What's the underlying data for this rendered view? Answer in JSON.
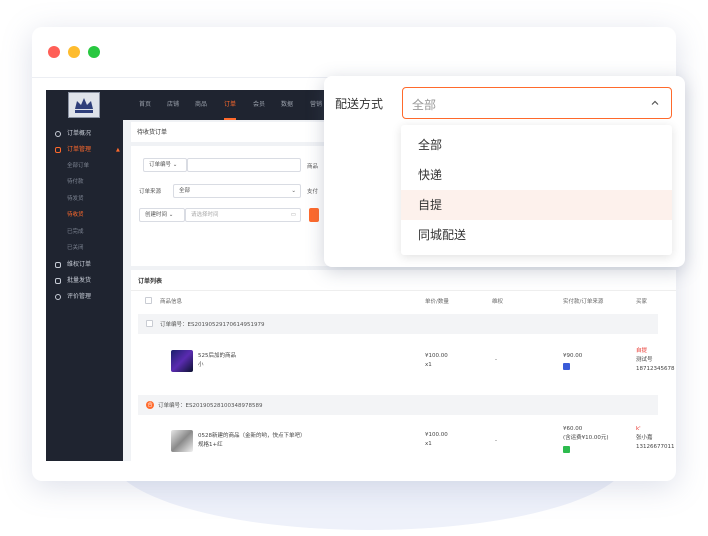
{
  "colors": {
    "accent": "#ff6a2c",
    "sidebar_bg": "#1f2430",
    "dot_red": "#ff5f57",
    "dot_yellow": "#febc2e",
    "dot_green": "#28c840"
  },
  "topnav": {
    "items": [
      "首页",
      "店铺",
      "商品",
      "订单",
      "会员",
      "数据",
      "营销"
    ]
  },
  "sidebar": {
    "items": [
      {
        "label": "订单概况",
        "icon": "clock-icon"
      },
      {
        "label": "订单管理",
        "icon": "document-icon"
      },
      {
        "label": "维权订单",
        "icon": "shield-icon"
      },
      {
        "label": "批量发货",
        "icon": "truck-icon"
      },
      {
        "label": "评价管理",
        "icon": "comment-icon"
      }
    ],
    "sub_items": [
      "全部订单",
      "待付款",
      "待发货",
      "待收货",
      "已完成",
      "已关闭"
    ],
    "active_sub": "待收货"
  },
  "page": {
    "breadcrumb": "待收货订单"
  },
  "filters": {
    "order_no_select": "订单编号",
    "product_label": "商品",
    "source_label": "订单来源",
    "source_value": "全部",
    "pay_label": "支付",
    "time_select": "创建时间",
    "time_placeholder": "请选择时间"
  },
  "list": {
    "title": "订单列表",
    "headers": [
      "商品信息",
      "单价/数量",
      "维权",
      "实付款/订单来源",
      "买家"
    ],
    "orders": [
      {
        "order_no": "订单编号：ES20190529170614951979",
        "product_name": "525后加的商品",
        "spec": "小",
        "price": "¥100.00",
        "qty": "x1",
        "rights": "-",
        "paid": "¥90.00",
        "buyer_tag": "自提",
        "buyer_name": "测试号",
        "buyer_phone": "18712345678"
      },
      {
        "order_no": "订单编号：ES20190528100348978589",
        "product_name": "0528新建的商品（金新的哟，快点下单吧）",
        "spec": "规格1+红",
        "price": "¥100.00",
        "qty": "x1",
        "rights": "-",
        "paid": "¥60.00",
        "paid_note": "(含运费¥10.00元)",
        "buyer_tag": "k'",
        "buyer_name": "张小嘉",
        "buyer_phone": "13126677011"
      }
    ]
  },
  "popup": {
    "label": "配送方式",
    "selected": "全部",
    "options": [
      "全部",
      "快递",
      "自提",
      "同城配送"
    ],
    "hovered": "自提"
  }
}
